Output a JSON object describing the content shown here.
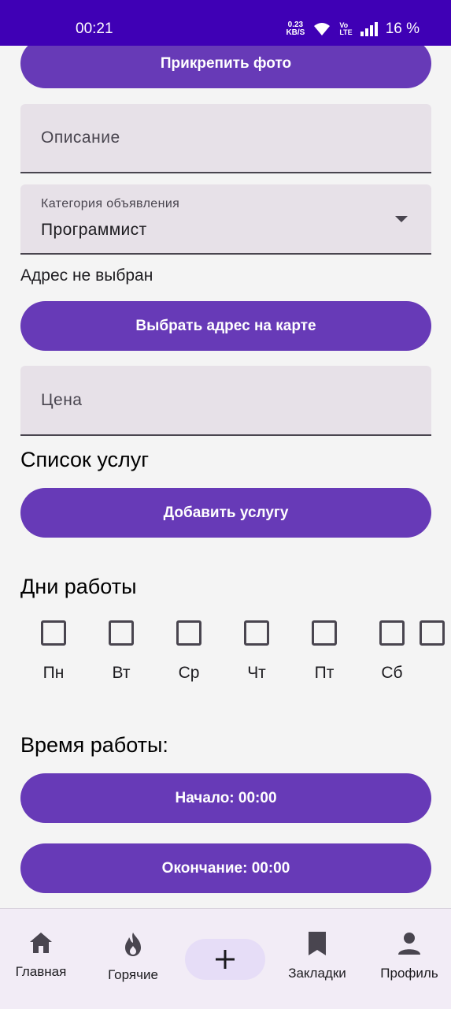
{
  "status_bar": {
    "time": "00:21",
    "net_speed_value": "0.23",
    "net_speed_unit": "KB/S",
    "volte_top": "Vo",
    "volte_bottom": "LTE",
    "battery": "16 %"
  },
  "form": {
    "attach_photo_button": "Прикрепить фото",
    "description_placeholder": "Описание",
    "category_label": "Категория объявления",
    "category_value": "Программист",
    "address_status": "Адрес не выбран",
    "choose_address_button": "Выбрать адрес на карте",
    "price_placeholder": "Цена",
    "services_title": "Список услуг",
    "add_service_button": "Добавить услугу",
    "workdays_title": "Дни работы",
    "days": [
      {
        "label": "Пн",
        "checked": false
      },
      {
        "label": "Вт",
        "checked": false
      },
      {
        "label": "Ср",
        "checked": false
      },
      {
        "label": "Чт",
        "checked": false
      },
      {
        "label": "Пт",
        "checked": false
      },
      {
        "label": "Сб",
        "checked": false
      },
      {
        "label": "",
        "checked": false
      }
    ],
    "worktime_title": "Время работы:",
    "start_button": "Начало: 00:00",
    "end_button": "Окончание: 00:00"
  },
  "bottom_nav": {
    "items": [
      {
        "label": "Главная",
        "icon": "home-icon"
      },
      {
        "label": "Горячие",
        "icon": "fire-icon"
      },
      {
        "label": "",
        "icon": "plus-icon"
      },
      {
        "label": "Закладки",
        "icon": "bookmark-icon"
      },
      {
        "label": "Профиль",
        "icon": "person-icon"
      }
    ]
  },
  "colors": {
    "status_bar": "#3f00b5",
    "accent": "#673ab7",
    "field_bg": "#e7e1e8",
    "nav_bg": "#f2ecf6"
  }
}
